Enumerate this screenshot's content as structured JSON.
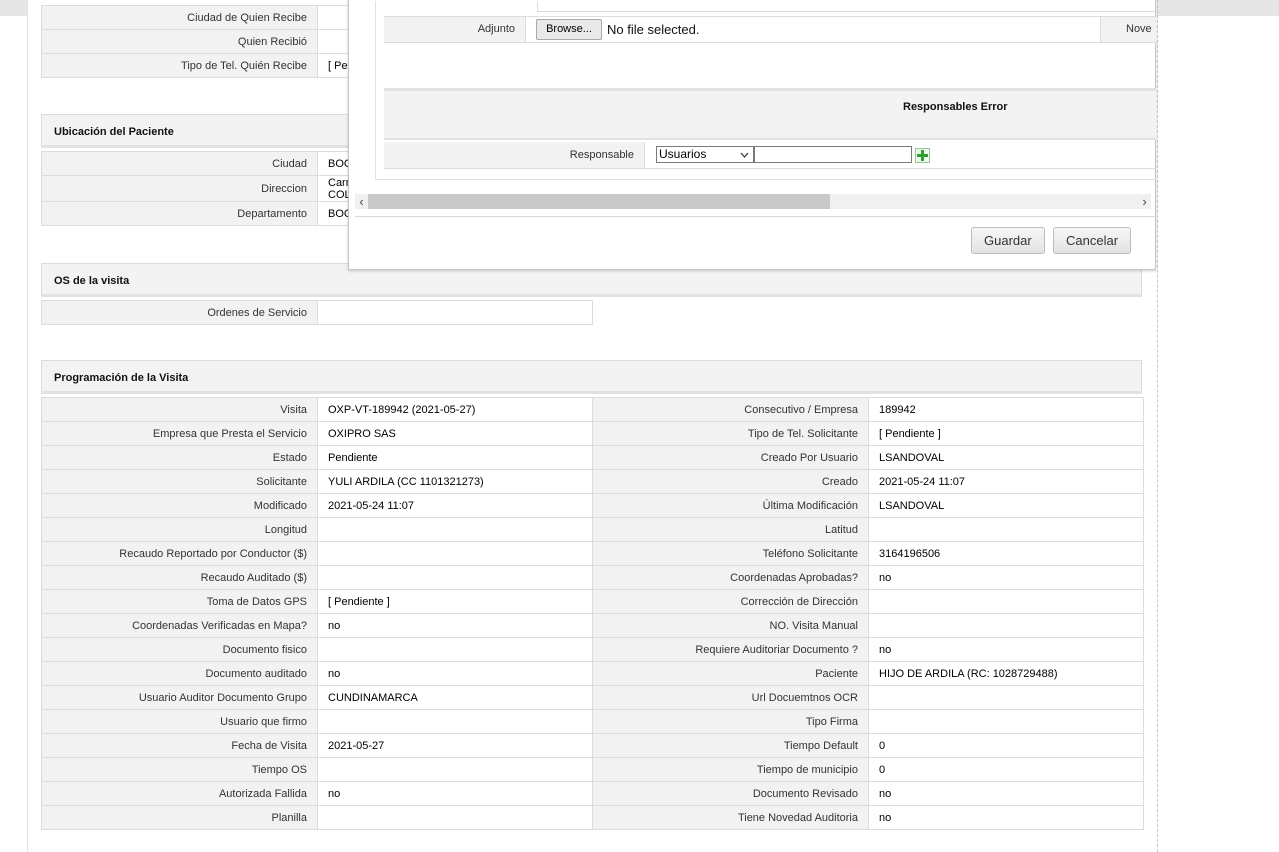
{
  "top_rows": [
    {
      "label": "Ciudad de Quien Recibe",
      "value": ""
    },
    {
      "label": "Quien Recibió",
      "value": ""
    },
    {
      "label": "Tipo de Tel. Quién Recibe",
      "value": "[ Pen"
    }
  ],
  "ubicacion": {
    "title": "Ubicación del Paciente",
    "rows": [
      {
        "label": "Ciudad",
        "value": "BOG"
      },
      {
        "label": "Direccion",
        "value1": "Carr",
        "value2": "COL"
      },
      {
        "label": "Departamento",
        "value": "BOG"
      }
    ]
  },
  "os_visita": {
    "title": "OS de la visita",
    "label": "Ordenes de Servicio",
    "value": ""
  },
  "programacion": {
    "title": "Programación de la Visita",
    "rows": [
      {
        "l1": "Visita",
        "v1": "OXP-VT-189942 (2021-05-27)",
        "l2": "Consecutivo / Empresa",
        "v2": "189942"
      },
      {
        "l1": "Empresa que Presta el Servicio",
        "v1": "OXIPRO SAS",
        "l2": "Tipo de Tel. Solicitante",
        "v2": "[ Pendiente ]"
      },
      {
        "l1": "Estado",
        "v1": "Pendiente",
        "l2": "Creado Por Usuario",
        "v2": "LSANDOVAL"
      },
      {
        "l1": "Solicitante",
        "v1": "YULI ARDILA (CC 1101321273)",
        "l2": "Creado",
        "v2": "2021-05-24 11:07"
      },
      {
        "l1": "Modificado",
        "v1": "2021-05-24 11:07",
        "l2": "Última Modificación",
        "v2": " LSANDOVAL"
      },
      {
        "l1": "Longitud",
        "v1": "",
        "l2": "Latitud",
        "v2": ""
      },
      {
        "l1": "Recaudo Reportado por Conductor ($)",
        "v1": "",
        "l2": "Teléfono Solicitante",
        "v2": "3164196506"
      },
      {
        "l1": "Recaudo Auditado ($)",
        "v1": "",
        "l2": "Coordenadas Aprobadas?",
        "v2": " no"
      },
      {
        "l1": "Toma de Datos GPS",
        "v1": "[ Pendiente ]",
        "l2": "Corrección de Dirección",
        "v2": ""
      },
      {
        "l1": "Coordenadas Verificadas en Mapa?",
        "v1": " no",
        "l2": "NO. Visita Manual",
        "v2": ""
      },
      {
        "l1": "Documento fisico",
        "v1": "",
        "l2": "Requiere Auditoriar Documento ?",
        "v2": " no"
      },
      {
        "l1": "Documento auditado",
        "v1": " no",
        "l2": "Paciente",
        "v2": "HIJO DE ARDILA (RC: 1028729488)"
      },
      {
        "l1": "Usuario Auditor Documento Grupo",
        "v1": "CUNDINAMARCA",
        "l2": "Url Docuemtnos OCR",
        "v2": ""
      },
      {
        "l1": "Usuario que firmo",
        "v1": "",
        "l2": "Tipo Firma",
        "v2": ""
      },
      {
        "l1": "Fecha de Visita",
        "v1": " 2021-05-27",
        "l2": "Tiempo Default",
        "v2": "0"
      },
      {
        "l1": "Tiempo OS",
        "v1": "",
        "l2": "Tiempo de municipio",
        "v2": "0"
      },
      {
        "l1": "Autorizada Fallida",
        "v1": " no",
        "l2": "Documento Revisado",
        "v2": " no"
      },
      {
        "l1": "Planilla",
        "v1": "",
        "l2": "Tiene Novedad Auditoria",
        "v2": " no"
      }
    ]
  },
  "dialog": {
    "adjunto_label": "Adjunto",
    "browse_label": "Browse...",
    "file_status": "No file selected.",
    "nove_label": "Nove",
    "responsables_title": "Responsables Error",
    "responsable_label": "Responsable",
    "select_value": "Usuarios",
    "save_label": "Guardar",
    "cancel_label": "Cancelar"
  },
  "icons": {
    "add": "plus-icon",
    "select": "chevron-down-icon",
    "scroll_left": "chevron-left-icon",
    "scroll_right": "chevron-right-icon"
  },
  "colors": {
    "label_bg": "#f2f2f2",
    "section_bg": "#f3f3f3",
    "plus_green": "#2e9e2e"
  }
}
